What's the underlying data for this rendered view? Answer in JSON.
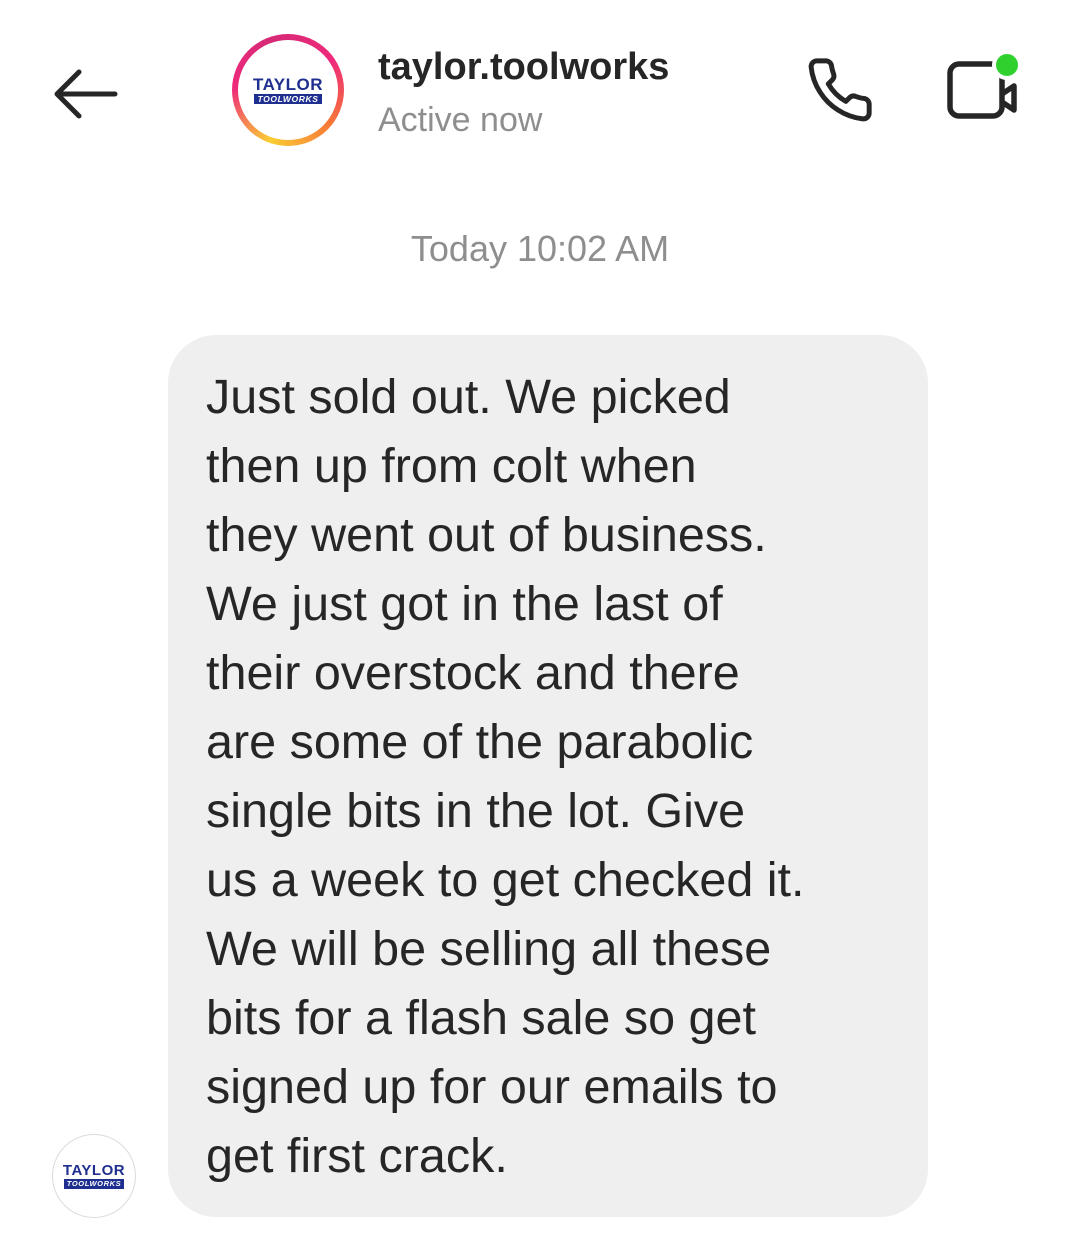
{
  "header": {
    "back_icon": "arrow-left-icon",
    "username": "taylor.toolworks",
    "status": "Active now",
    "call_icon": "phone-icon",
    "video_icon": "video-camera-icon",
    "online_color": "#2fd12f",
    "avatar": {
      "logo_top": "TAYLOR",
      "logo_bottom": "TOOLWORKS"
    }
  },
  "thread": {
    "timestamp": "Today 10:02 AM",
    "messages": [
      {
        "sender": "taylor.toolworks",
        "text": "Just sold out. We picked then up from colt when they went out of business. We just got in the last of their overstock and there are some of the parabolic single bits in the lot. Give us a week to get checked it. We will be selling all these bits for a flash sale so get signed up for our emails to get first crack.",
        "lines": [
          "Just sold out. We picked",
          "then up from colt when",
          "they went out of business.",
          "We just got in the last of",
          "their overstock and there",
          "are some of the parabolic",
          "single bits in the lot. Give",
          "us a week to get checked it.",
          "We will be selling all these",
          "bits for a flash sale so get",
          "signed up for our emails to",
          "get first crack."
        ],
        "avatar": {
          "logo_top": "TAYLOR",
          "logo_bottom": "TOOLWORKS"
        }
      }
    ]
  },
  "colors": {
    "bubble_background": "#efefef",
    "text": "#262626",
    "secondary_text": "#8e8e8e",
    "logo_blue": "#1f2f8f"
  }
}
